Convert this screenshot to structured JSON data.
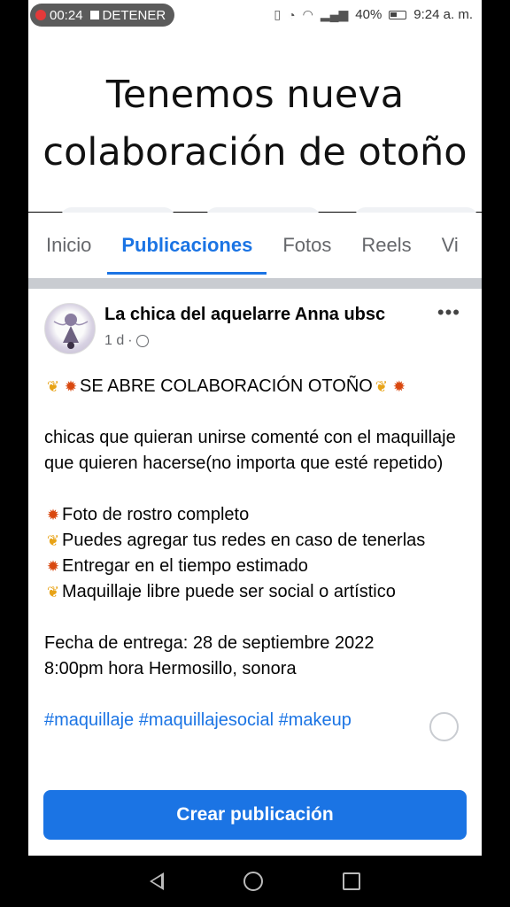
{
  "status_bar": {
    "recording_time": "00:24",
    "recording_action": "DETENER",
    "battery": "40%",
    "time": "9:24 a. m."
  },
  "caption": {
    "line1": "Tenemos nueva",
    "line2": "colaboración de otoño"
  },
  "tabs": [
    {
      "label": "Inicio",
      "active": false
    },
    {
      "label": "Publicaciones",
      "active": true
    },
    {
      "label": "Fotos",
      "active": false
    },
    {
      "label": "Reels",
      "active": false
    },
    {
      "label": "Vi",
      "active": false
    }
  ],
  "post": {
    "author": "La chica del aquelarre Anna ubsc",
    "age": "1 d",
    "title": "SE ABRE COLABORACIÓN OTOÑO",
    "paragraph1": "chicas que quieran unirse comenté con el maquillaje que quieren hacerse(no importa que esté repetido)",
    "bullets": [
      "Foto de rostro completo",
      "Puedes agregar tus redes en caso de tenerlas",
      "Entregar en el tiempo estimado",
      "Maquillaje libre puede ser social o artístico"
    ],
    "delivery_line1": "Fecha de entrega: 28 de septiembre 2022",
    "delivery_line2": "8:00pm hora Hermosillo, sonora",
    "hashtags": "#maquillaje  #maquillajesocial  #makeup"
  },
  "create_post_label": "Crear publicación"
}
